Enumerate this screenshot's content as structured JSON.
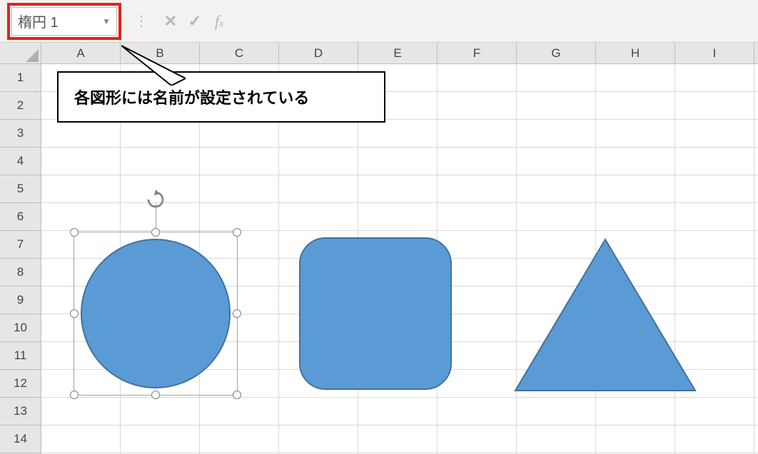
{
  "name_box": {
    "value": "楕円 1"
  },
  "callout": {
    "text": "各図形には名前が設定されている"
  },
  "columns": [
    "A",
    "B",
    "C",
    "D",
    "E",
    "F",
    "G",
    "H",
    "I"
  ],
  "rows": [
    "1",
    "2",
    "3",
    "4",
    "5",
    "6",
    "7",
    "8",
    "9",
    "10",
    "11",
    "12",
    "13",
    "14"
  ],
  "shape_fill": "#5b9bd5",
  "shape_stroke": "#41719c"
}
